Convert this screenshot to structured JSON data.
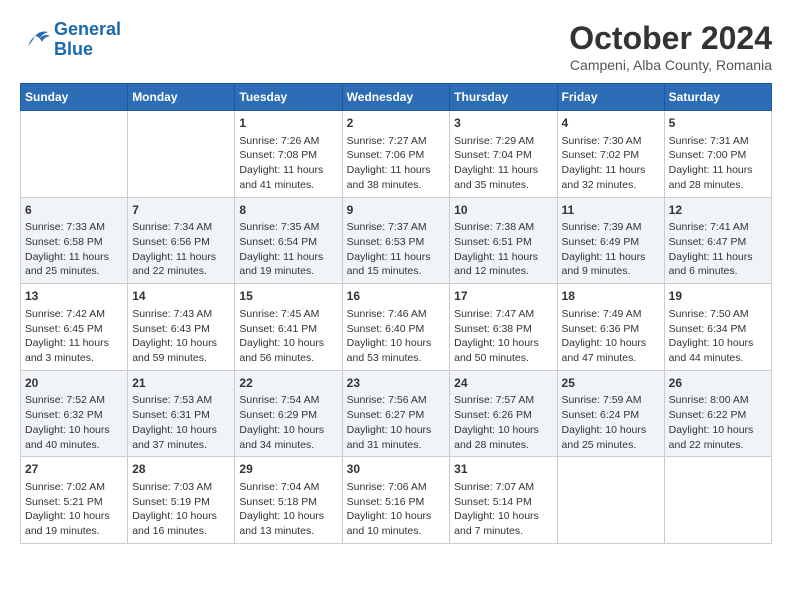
{
  "logo": {
    "line1": "General",
    "line2": "Blue"
  },
  "title": "October 2024",
  "location": "Campeni, Alba County, Romania",
  "days_of_week": [
    "Sunday",
    "Monday",
    "Tuesday",
    "Wednesday",
    "Thursday",
    "Friday",
    "Saturday"
  ],
  "weeks": [
    [
      {
        "day": "",
        "content": ""
      },
      {
        "day": "",
        "content": ""
      },
      {
        "day": "1",
        "content": "Sunrise: 7:26 AM\nSunset: 7:08 PM\nDaylight: 11 hours and 41 minutes."
      },
      {
        "day": "2",
        "content": "Sunrise: 7:27 AM\nSunset: 7:06 PM\nDaylight: 11 hours and 38 minutes."
      },
      {
        "day": "3",
        "content": "Sunrise: 7:29 AM\nSunset: 7:04 PM\nDaylight: 11 hours and 35 minutes."
      },
      {
        "day": "4",
        "content": "Sunrise: 7:30 AM\nSunset: 7:02 PM\nDaylight: 11 hours and 32 minutes."
      },
      {
        "day": "5",
        "content": "Sunrise: 7:31 AM\nSunset: 7:00 PM\nDaylight: 11 hours and 28 minutes."
      }
    ],
    [
      {
        "day": "6",
        "content": "Sunrise: 7:33 AM\nSunset: 6:58 PM\nDaylight: 11 hours and 25 minutes."
      },
      {
        "day": "7",
        "content": "Sunrise: 7:34 AM\nSunset: 6:56 PM\nDaylight: 11 hours and 22 minutes."
      },
      {
        "day": "8",
        "content": "Sunrise: 7:35 AM\nSunset: 6:54 PM\nDaylight: 11 hours and 19 minutes."
      },
      {
        "day": "9",
        "content": "Sunrise: 7:37 AM\nSunset: 6:53 PM\nDaylight: 11 hours and 15 minutes."
      },
      {
        "day": "10",
        "content": "Sunrise: 7:38 AM\nSunset: 6:51 PM\nDaylight: 11 hours and 12 minutes."
      },
      {
        "day": "11",
        "content": "Sunrise: 7:39 AM\nSunset: 6:49 PM\nDaylight: 11 hours and 9 minutes."
      },
      {
        "day": "12",
        "content": "Sunrise: 7:41 AM\nSunset: 6:47 PM\nDaylight: 11 hours and 6 minutes."
      }
    ],
    [
      {
        "day": "13",
        "content": "Sunrise: 7:42 AM\nSunset: 6:45 PM\nDaylight: 11 hours and 3 minutes."
      },
      {
        "day": "14",
        "content": "Sunrise: 7:43 AM\nSunset: 6:43 PM\nDaylight: 10 hours and 59 minutes."
      },
      {
        "day": "15",
        "content": "Sunrise: 7:45 AM\nSunset: 6:41 PM\nDaylight: 10 hours and 56 minutes."
      },
      {
        "day": "16",
        "content": "Sunrise: 7:46 AM\nSunset: 6:40 PM\nDaylight: 10 hours and 53 minutes."
      },
      {
        "day": "17",
        "content": "Sunrise: 7:47 AM\nSunset: 6:38 PM\nDaylight: 10 hours and 50 minutes."
      },
      {
        "day": "18",
        "content": "Sunrise: 7:49 AM\nSunset: 6:36 PM\nDaylight: 10 hours and 47 minutes."
      },
      {
        "day": "19",
        "content": "Sunrise: 7:50 AM\nSunset: 6:34 PM\nDaylight: 10 hours and 44 minutes."
      }
    ],
    [
      {
        "day": "20",
        "content": "Sunrise: 7:52 AM\nSunset: 6:32 PM\nDaylight: 10 hours and 40 minutes."
      },
      {
        "day": "21",
        "content": "Sunrise: 7:53 AM\nSunset: 6:31 PM\nDaylight: 10 hours and 37 minutes."
      },
      {
        "day": "22",
        "content": "Sunrise: 7:54 AM\nSunset: 6:29 PM\nDaylight: 10 hours and 34 minutes."
      },
      {
        "day": "23",
        "content": "Sunrise: 7:56 AM\nSunset: 6:27 PM\nDaylight: 10 hours and 31 minutes."
      },
      {
        "day": "24",
        "content": "Sunrise: 7:57 AM\nSunset: 6:26 PM\nDaylight: 10 hours and 28 minutes."
      },
      {
        "day": "25",
        "content": "Sunrise: 7:59 AM\nSunset: 6:24 PM\nDaylight: 10 hours and 25 minutes."
      },
      {
        "day": "26",
        "content": "Sunrise: 8:00 AM\nSunset: 6:22 PM\nDaylight: 10 hours and 22 minutes."
      }
    ],
    [
      {
        "day": "27",
        "content": "Sunrise: 7:02 AM\nSunset: 5:21 PM\nDaylight: 10 hours and 19 minutes."
      },
      {
        "day": "28",
        "content": "Sunrise: 7:03 AM\nSunset: 5:19 PM\nDaylight: 10 hours and 16 minutes."
      },
      {
        "day": "29",
        "content": "Sunrise: 7:04 AM\nSunset: 5:18 PM\nDaylight: 10 hours and 13 minutes."
      },
      {
        "day": "30",
        "content": "Sunrise: 7:06 AM\nSunset: 5:16 PM\nDaylight: 10 hours and 10 minutes."
      },
      {
        "day": "31",
        "content": "Sunrise: 7:07 AM\nSunset: 5:14 PM\nDaylight: 10 hours and 7 minutes."
      },
      {
        "day": "",
        "content": ""
      },
      {
        "day": "",
        "content": ""
      }
    ]
  ]
}
